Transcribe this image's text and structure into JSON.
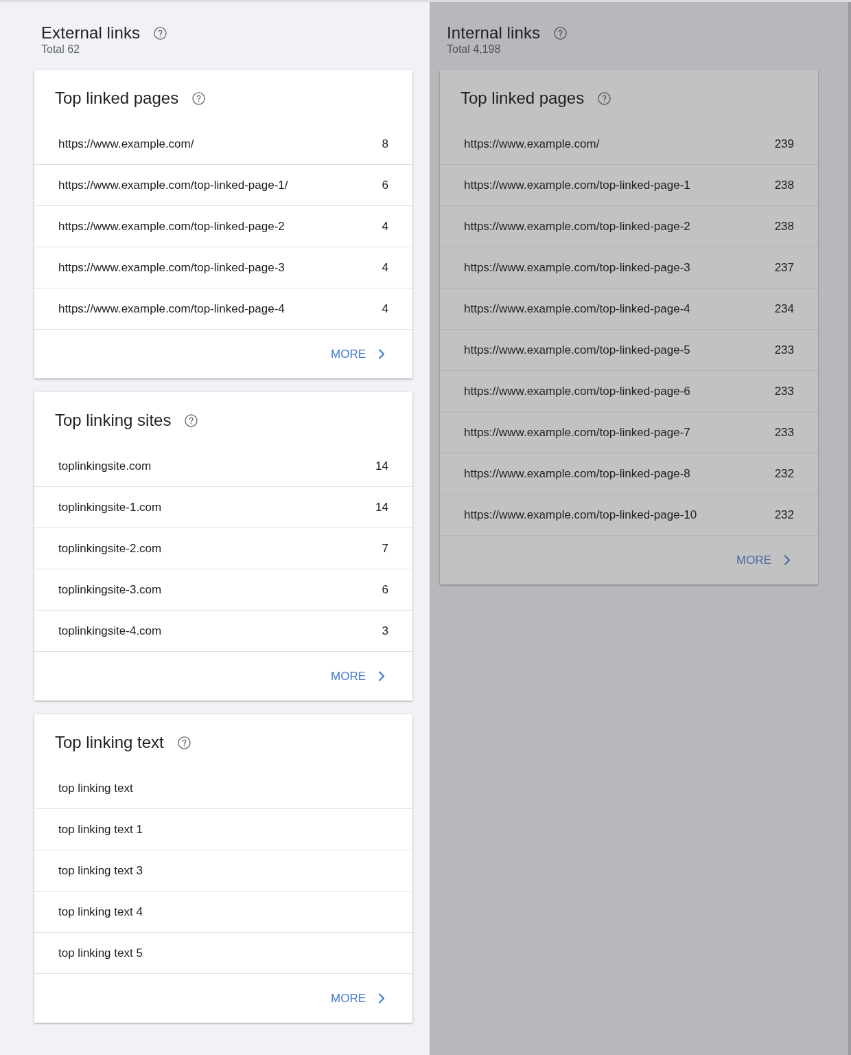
{
  "sections": [
    {
      "title": "External links",
      "total": "Total 62",
      "dimmed": false,
      "cards": [
        {
          "title": "Top linked pages",
          "rows": [
            {
              "label": "https://www.example.com/",
              "count": "8"
            },
            {
              "label": "https://www.example.com/top-linked-page-1/",
              "count": "6"
            },
            {
              "label": "https://www.example.com/top-linked-page-2",
              "count": "4"
            },
            {
              "label": "https://www.example.com/top-linked-page-3",
              "count": "4"
            },
            {
              "label": "https://www.example.com/top-linked-page-4",
              "count": "4"
            }
          ],
          "more": "MORE"
        },
        {
          "title": "Top linking sites",
          "rows": [
            {
              "label": "toplinkingsite.com",
              "count": "14"
            },
            {
              "label": "toplinkingsite-1.com",
              "count": "14"
            },
            {
              "label": "toplinkingsite-2.com",
              "count": "7"
            },
            {
              "label": "toplinkingsite-3.com",
              "count": "6"
            },
            {
              "label": "toplinkingsite-4.com",
              "count": "3"
            }
          ],
          "more": "MORE"
        },
        {
          "title": "Top linking text",
          "rows": [
            {
              "label": "top linking text"
            },
            {
              "label": "top linking text 1"
            },
            {
              "label": "top linking text 3"
            },
            {
              "label": "top linking text 4"
            },
            {
              "label": "top linking text 5"
            }
          ],
          "more": "MORE"
        }
      ]
    },
    {
      "title": "Internal links",
      "total": "Total 4,198",
      "dimmed": true,
      "cards": [
        {
          "title": "Top linked pages",
          "rows": [
            {
              "label": "https://www.example.com/",
              "count": "239"
            },
            {
              "label": "https://www.example.com/top-linked-page-1",
              "count": "238"
            },
            {
              "label": "https://www.example.com/top-linked-page-2",
              "count": "238"
            },
            {
              "label": "https://www.example.com/top-linked-page-3",
              "count": "237"
            },
            {
              "label": "https://www.example.com/top-linked-page-4",
              "count": "234"
            },
            {
              "label": "https://www.example.com/top-linked-page-5",
              "count": "233"
            },
            {
              "label": "https://www.example.com/top-linked-page-6",
              "count": "233"
            },
            {
              "label": "https://www.example.com/top-linked-page-7",
              "count": "233"
            },
            {
              "label": "https://www.example.com/top-linked-page-8",
              "count": "232"
            },
            {
              "label": "https://www.example.com/top-linked-page-10",
              "count": "232"
            }
          ],
          "more": "MORE"
        }
      ]
    }
  ]
}
